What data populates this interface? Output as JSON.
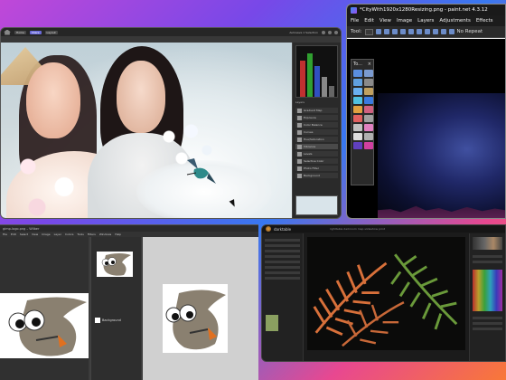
{
  "photoshop": {
    "tabs": [
      "Home",
      "Share",
      "Layout"
    ],
    "titlebar_text": "Autosave  1 Selection",
    "panel_tab": "Layers",
    "layers": [
      "Gradient Map",
      "Exposure",
      "Color Balance",
      "Curves",
      "Hue/Saturation",
      "Vibrance",
      "Levels",
      "Selective Color",
      "Photo Filter",
      "Background"
    ]
  },
  "paintnet": {
    "title": "*CityWith1920x1280Resizing.png - paint.net 4.3.12",
    "menu": [
      "File",
      "Edit",
      "View",
      "Image",
      "Layers",
      "Adjustments",
      "Effects"
    ],
    "tool_label": "Tool:",
    "repeat_label": "No Repeat",
    "tools_window_title": "To...",
    "tools_close": "×"
  },
  "gimp": {
    "title": "gimp-logo.png – Wilber",
    "menu": [
      "File",
      "Edit",
      "Select",
      "View",
      "Image",
      "Layer",
      "Colors",
      "Tools",
      "Filters",
      "Windows",
      "Help"
    ],
    "layer_name": "Background"
  },
  "darktable": {
    "title": "darktable",
    "subtitle": "lighttable  darkroom  map  slideshow  print"
  },
  "colors": {
    "ps_accent": "#6a6ad8",
    "pdn_accent": "#3a8ef0",
    "desktop_top": "#c048d8",
    "desktop_bottom": "#f87838"
  }
}
